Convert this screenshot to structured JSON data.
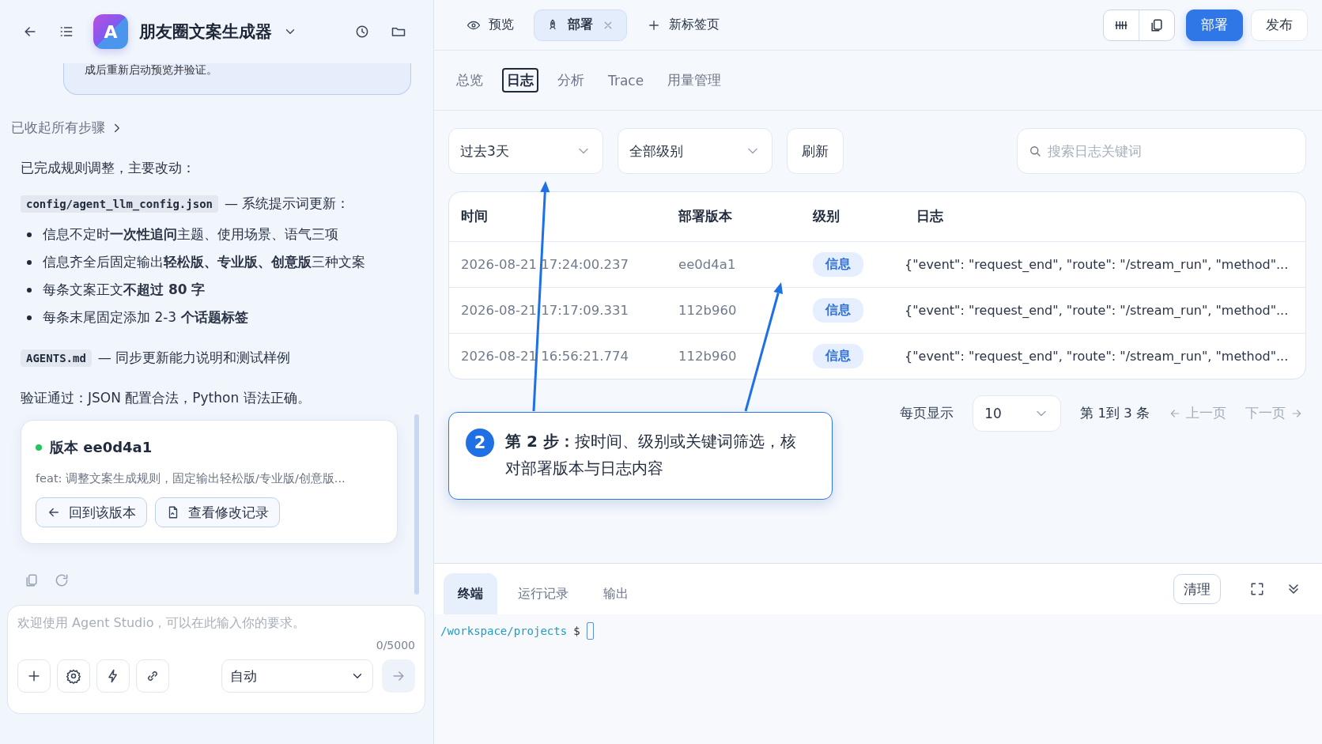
{
  "header": {
    "avatar_letter": "A",
    "app_title": "朋友圈文案生成器"
  },
  "chat": {
    "previous_message": "成后重新启动预览并验证。",
    "collapsed_steps": "已收起所有步骤",
    "intro": "已完成规则调整，主要改动：",
    "changes": [
      {
        "file": "config/agent_llm_config.json",
        "note": "— 系统提示词更新：",
        "bullets": [
          "信息不定时**一次性追问**主题、使用场景、语气三项",
          "信息齐全后固定输出**轻松版、专业版、创意版**三种文案",
          "每条文案正文**不超过 80 字**",
          "每条末尾固定添加 2-3 **个话题标签**"
        ]
      },
      {
        "file": "AGENTS.md",
        "note": "— 同步更新能力说明和测试样例"
      }
    ],
    "verification": "验证通过：JSON 配置合法，Python 语法正确。",
    "version_card": {
      "title": "版本 ee0d4a1",
      "description": "feat: 调整文案生成规则，固定输出轻松版/专业版/创意版...",
      "buttons": [
        {
          "label": "回到该版本",
          "kind": "back"
        },
        {
          "label": "查看修改记录",
          "kind": "file"
        }
      ]
    }
  },
  "composer": {
    "placeholder": "欢迎使用 Agent Studio，可以在此输入你的要求。",
    "counter": "0/5000",
    "mode": "自动"
  },
  "top_tabs": [
    {
      "label": "预览",
      "selected": false,
      "closable": false,
      "kind": "eye"
    },
    {
      "label": "部署",
      "selected": true,
      "closable": true,
      "kind": "rocket"
    }
  ],
  "new_tab": "新标签页",
  "actions": [
    {
      "label": "部署",
      "primary": true
    },
    {
      "label": "发布",
      "primary": false
    }
  ],
  "sub_tabs": [
    {
      "label": "总览",
      "selected": false
    },
    {
      "label": "日志",
      "selected": true
    },
    {
      "label": "分析",
      "selected": false
    },
    {
      "label": "Trace",
      "selected": false
    },
    {
      "label": "用量管理",
      "selected": false
    }
  ],
  "filters": {
    "time_range": "过去3天",
    "level": "全部级别",
    "refresh": "刷新",
    "search_placeholder": "搜索日志关键词"
  },
  "table": {
    "columns": [
      "时间",
      "部署版本",
      "级别",
      "日志"
    ],
    "rows": [
      {
        "time": "2026-08-21 17:24:00.237",
        "version": "ee0d4a1",
        "level": "信息",
        "log": "{\"event\": \"request_end\", \"route\": \"/stream_run\", \"method\"..."
      },
      {
        "time": "2026-08-21 17:17:09.331",
        "version": "112b960",
        "level": "信息",
        "log": "{\"event\": \"request_end\", \"route\": \"/stream_run\", \"method\"..."
      },
      {
        "time": "2026-08-21 16:56:21.774",
        "version": "112b960",
        "level": "信息",
        "log": "{\"event\": \"request_end\", \"route\": \"/stream_run\", \"method\"..."
      }
    ]
  },
  "pagination": {
    "page_size_label": "每页显示",
    "page_size": "10",
    "range": "第 1到 3 条",
    "prev": "上一页",
    "next": "下一页"
  },
  "callout": {
    "step": "2",
    "text": "**第 2 步：**按时间、级别或关键词筛选，核对部署版本与日志内容"
  },
  "terminal": {
    "tabs": [
      {
        "label": "终端",
        "selected": true
      },
      {
        "label": "运行记录",
        "selected": false
      },
      {
        "label": "输出",
        "selected": false
      }
    ],
    "clear": "清理",
    "path": "/workspace/projects",
    "prompt": "$"
  }
}
